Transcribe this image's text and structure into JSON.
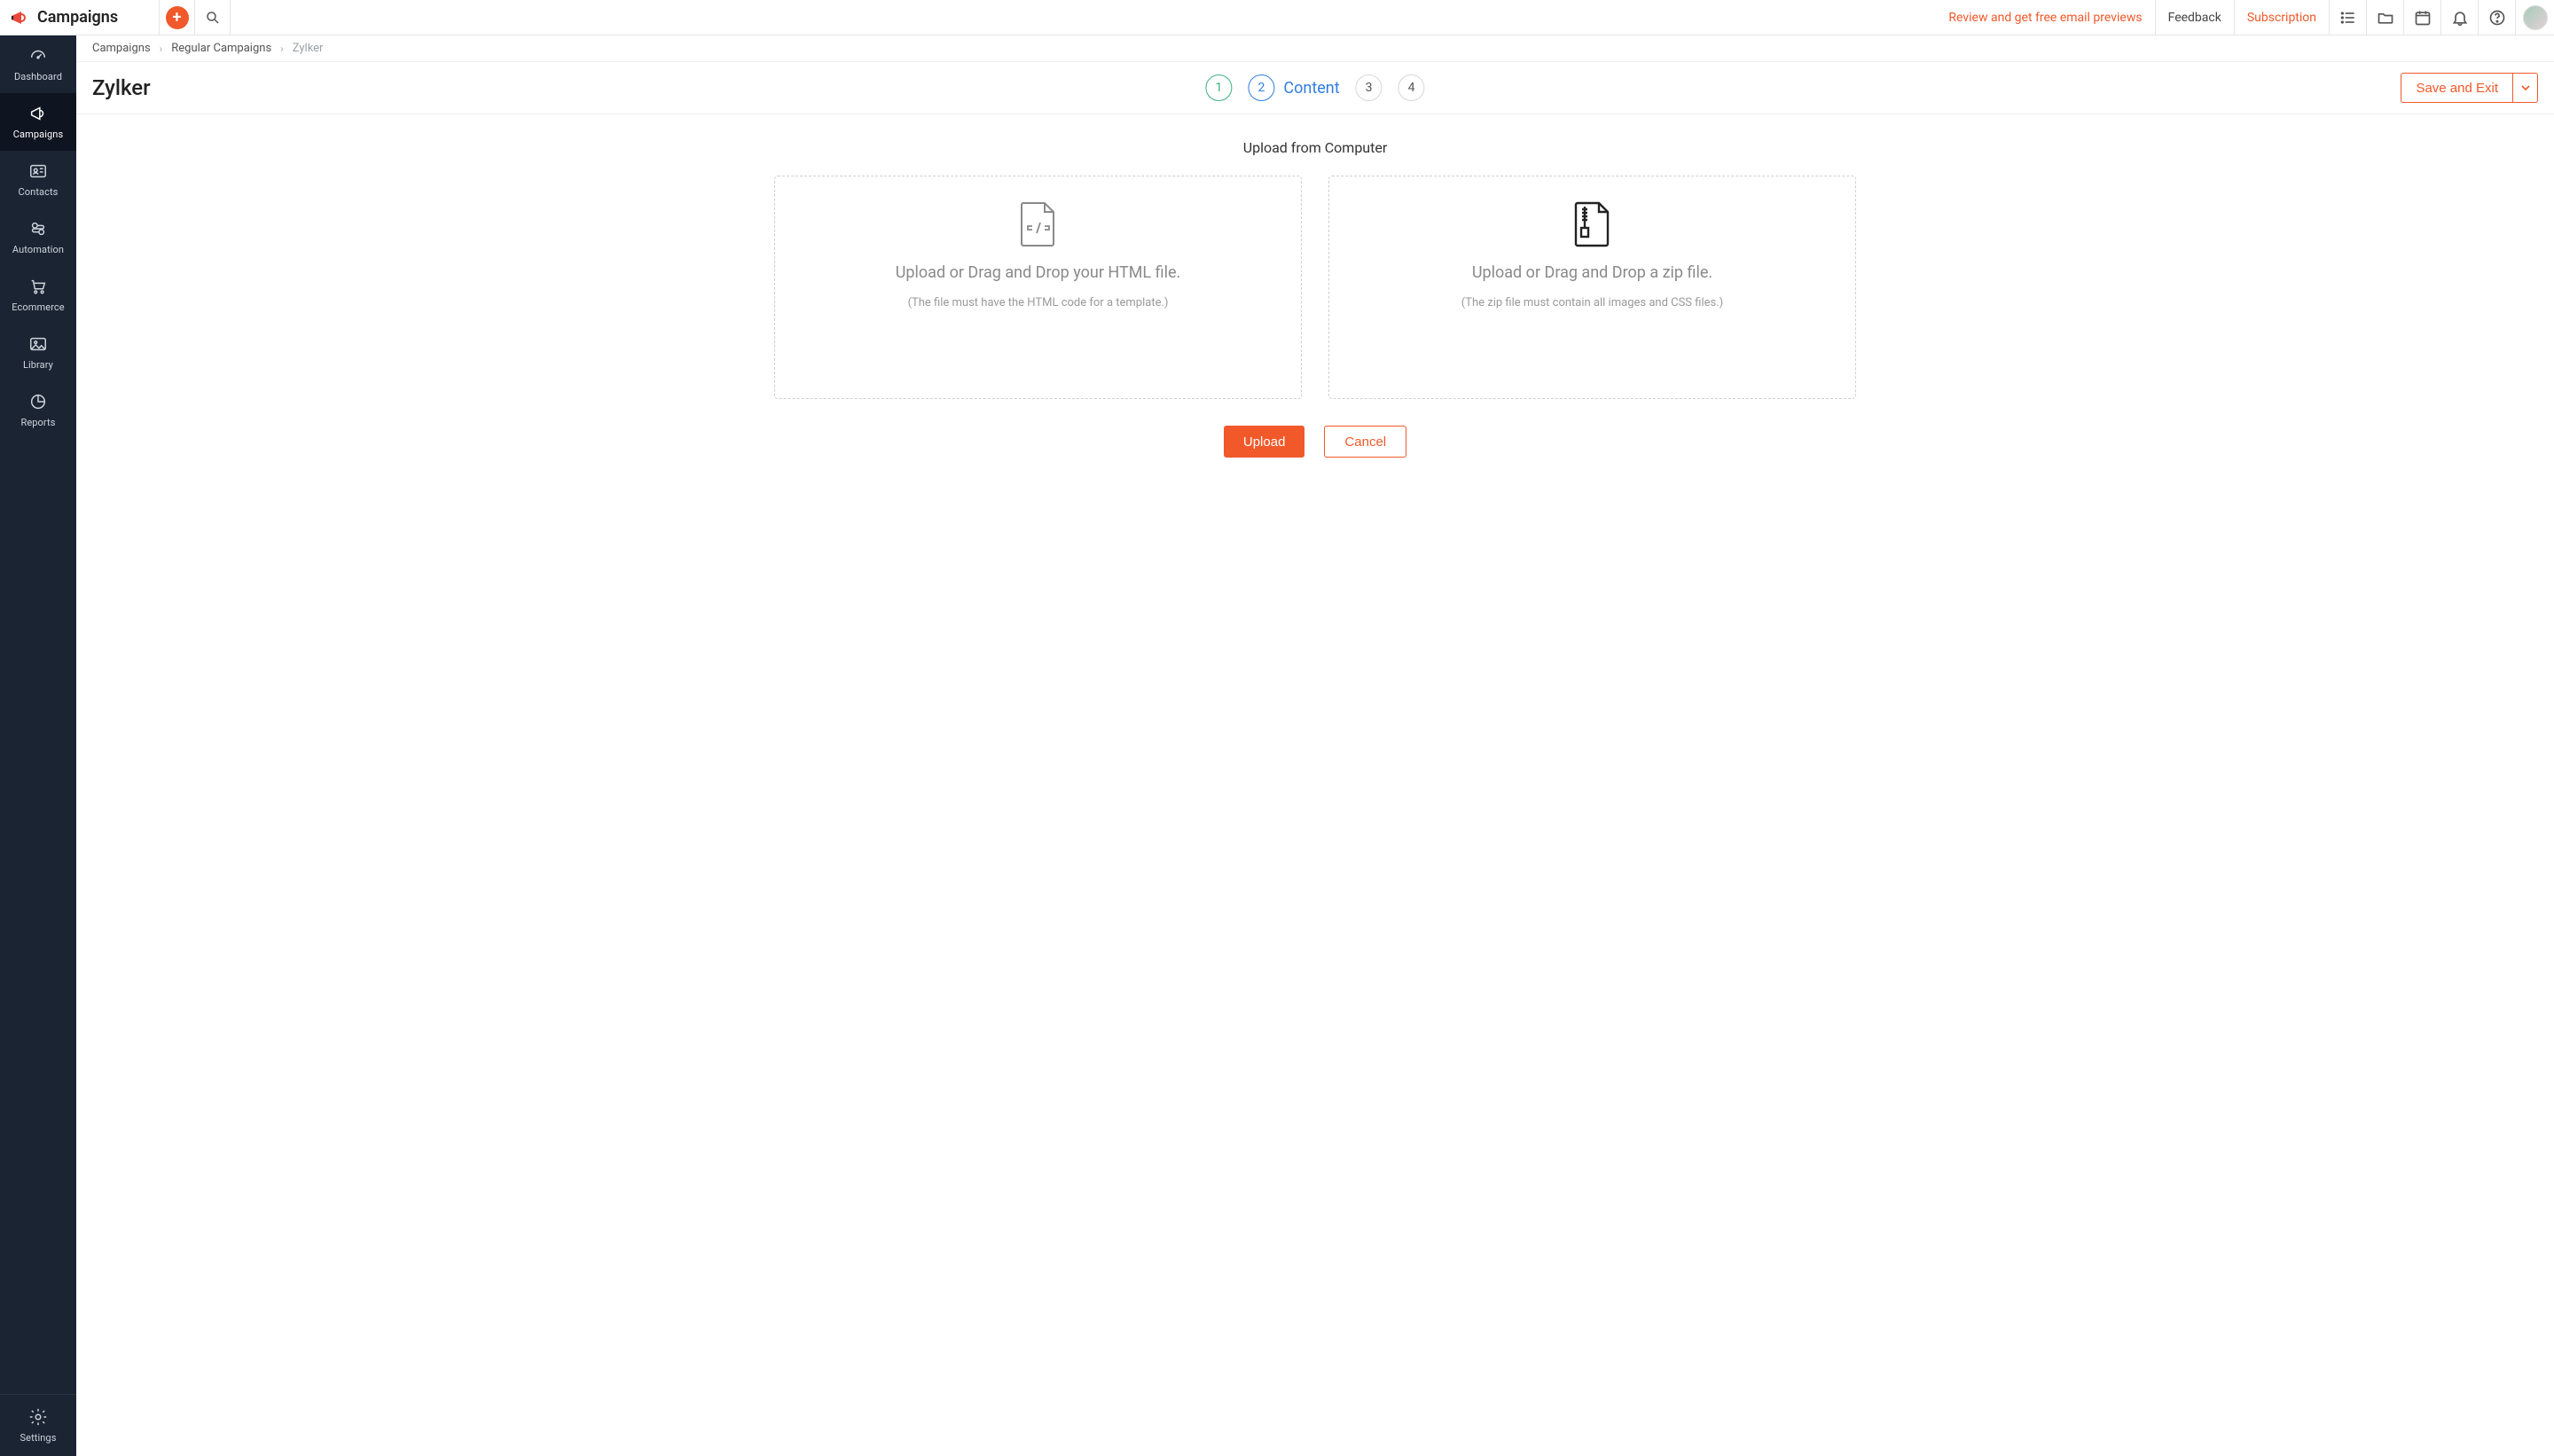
{
  "brand": {
    "title": "Campaigns"
  },
  "topbar": {
    "review_link": "Review and get free email previews",
    "feedback": "Feedback",
    "subscription": "Subscription"
  },
  "sidenav": {
    "items": [
      {
        "label": "Dashboard"
      },
      {
        "label": "Campaigns"
      },
      {
        "label": "Contacts"
      },
      {
        "label": "Automation"
      },
      {
        "label": "Ecommerce"
      },
      {
        "label": "Library"
      },
      {
        "label": "Reports"
      }
    ],
    "settings": "Settings"
  },
  "breadcrumbs": {
    "items": [
      "Campaigns",
      "Regular Campaigns"
    ],
    "current": "Zylker"
  },
  "page": {
    "title": "Zylker",
    "save_exit": "Save and Exit"
  },
  "stepper": {
    "steps": [
      {
        "num": "1"
      },
      {
        "num": "2",
        "label": "Content"
      },
      {
        "num": "3"
      },
      {
        "num": "4"
      }
    ]
  },
  "upload": {
    "section_title": "Upload from Computer",
    "html_title": "Upload or Drag and Drop your HTML file.",
    "html_sub": "(The file must have the HTML code for a template.)",
    "zip_title": "Upload or Drag and Drop a zip file.",
    "zip_sub": "(The zip file must contain all images and CSS files.)",
    "upload_btn": "Upload",
    "cancel_btn": "Cancel"
  }
}
